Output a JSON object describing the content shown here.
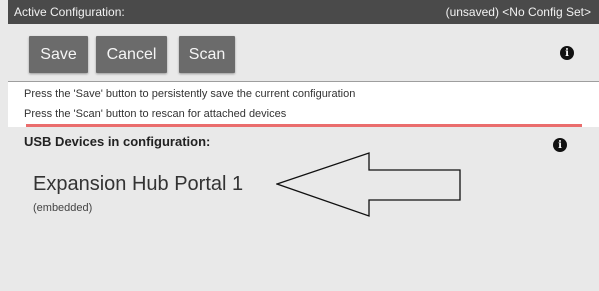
{
  "title_bar": {
    "label": "Active Configuration:",
    "status": "(unsaved) <No Config Set>"
  },
  "toolbar": {
    "save_label": "Save",
    "cancel_label": "Cancel",
    "scan_label": "Scan",
    "info_icon": "info-icon"
  },
  "help": {
    "line1": "Press the 'Save' button to persistently save the current configuration",
    "line2": "Press the 'Scan' button to rescan for attached devices"
  },
  "usb": {
    "header": "USB Devices in configuration:",
    "info_icon": "info-icon"
  },
  "devices": [
    {
      "name": "Expansion Hub Portal 1",
      "sub": "(embedded)"
    }
  ],
  "annotation": {
    "icon": "arrow-left-outline-icon"
  },
  "colors": {
    "title_bar_bg": "#4a4a4a",
    "button_bg": "#6b6b6b",
    "divider_accent": "#ea6d6d",
    "page_bg": "#e9e9e9"
  }
}
